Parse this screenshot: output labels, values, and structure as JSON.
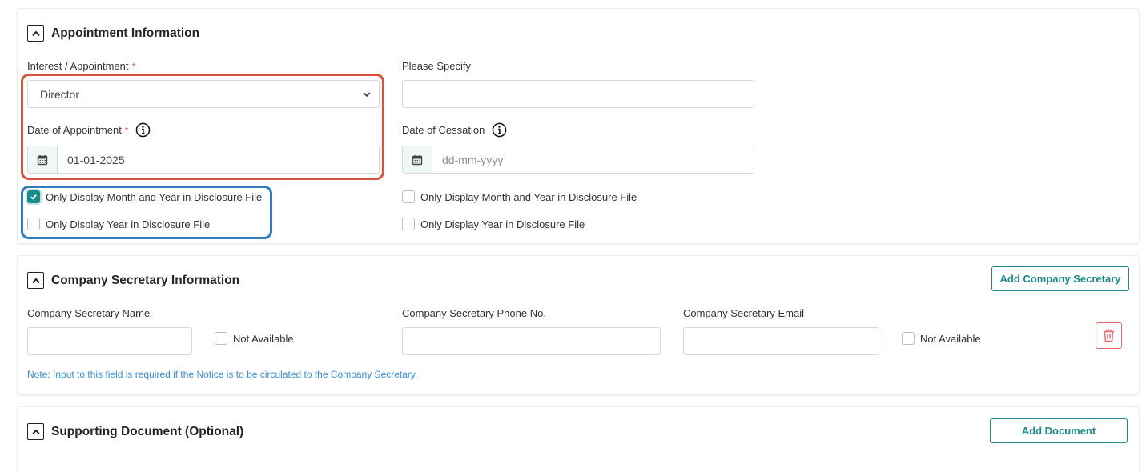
{
  "appointment": {
    "title": "Appointment Information",
    "interest_label": "Interest / Appointment",
    "required_mark": "*",
    "interest_value": "Director",
    "please_specify_label": "Please Specify",
    "please_specify_value": "",
    "date_appointment_label": "Date of Appointment",
    "date_appointment_value": "01-01-2025",
    "date_cessation_label": "Date of Cessation",
    "date_cessation_placeholder": "dd-mm-yyyy",
    "left_checks": [
      {
        "label": "Only Display Month and Year in Disclosure File",
        "checked": true
      },
      {
        "label": "Only Display Year in Disclosure File",
        "checked": false
      }
    ],
    "right_checks": [
      {
        "label": "Only Display Month and Year in Disclosure File",
        "checked": false
      },
      {
        "label": "Only Display Year in Disclosure File",
        "checked": false
      }
    ]
  },
  "secretary": {
    "title": "Company Secretary Information",
    "add_button": "Add Company Secretary",
    "name_label": "Company Secretary Name",
    "phone_label": "Company Secretary Phone No.",
    "email_label": "Company Secretary Email",
    "not_available_1": "Not Available",
    "not_available_2": "Not Available",
    "note": "Note: Input to this field is required if the Notice is to be circulated to the Company Secretary."
  },
  "support": {
    "title": "Supporting Document (Optional)",
    "add_button": "Add Document"
  },
  "colors": {
    "accent": "#1a8a8a",
    "highlight_red": "#d9533c",
    "highlight_blue": "#2f7cc0",
    "note_blue": "#3a8fd8",
    "delete_red": "#e36b6b"
  }
}
